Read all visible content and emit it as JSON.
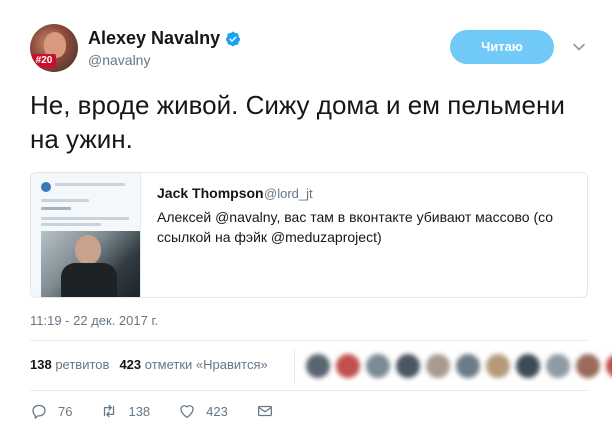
{
  "author": {
    "name": "Alexey Navalny",
    "handle": "@navalny",
    "avatar_badge": "#20",
    "verified": true
  },
  "follow_button": {
    "label": "Читаю"
  },
  "tweet": {
    "text": "Не, вроде живой. Сижу дома и ем пельмени на ужин."
  },
  "quoted_tweet": {
    "author_name": "Jack Thompson",
    "author_handle": "@lord_jt",
    "text": "Алексей @navalny, вас там в вконтакте убивают массово (со ссылкой на фэйк @meduzaproject)",
    "thumbnail_title": "Уголовное самоуправление *АФИС...",
    "thumbnail_lines": [
      "Двенадцать,",
      "— Meduza",
      "Алексей Навальный убит сегодня в 21:33 в подъезде своего дома"
    ]
  },
  "timestamp": "11:19 - 22 дек. 2017 г.",
  "stats": {
    "retweets_count": "138",
    "retweets_label": "ретвитов",
    "likes_count": "423",
    "likes_label": "отметки «Нравится»"
  },
  "actions": {
    "reply_count": "76",
    "retweet_count": "138",
    "like_count": "423"
  },
  "colors": {
    "follow_button": "#71c9f8",
    "verified": "#1da1f2",
    "secondary_text": "#657786"
  },
  "liker_avatar_colors": [
    "#5a6470",
    "#c0504d",
    "#7a8a96",
    "#4a5560",
    "#a89a90",
    "#6b7c88",
    "#b59a7a",
    "#3d4a55",
    "#8f9aa3",
    "#9a6a5a",
    "#c24a4a"
  ]
}
